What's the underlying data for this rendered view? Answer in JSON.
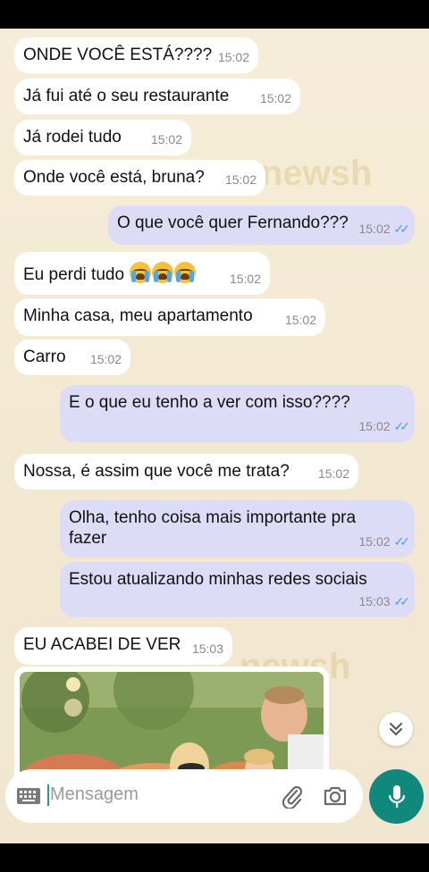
{
  "messages": [
    {
      "text": "ONDE VOCÊ ESTÁ????",
      "time": "15:02",
      "dir": "in"
    },
    {
      "text": "Já fui até o seu restaurante",
      "time": "15:02",
      "dir": "in"
    },
    {
      "text": "Já rodei tudo",
      "time": "15:02",
      "dir": "in"
    },
    {
      "text": "Onde você está, bruna?",
      "time": "15:02",
      "dir": "in"
    },
    {
      "text": "O que você quer Fernando???",
      "time": "15:02",
      "dir": "out",
      "status": "read"
    },
    {
      "text": "Eu perdi tudo",
      "time": "15:02",
      "dir": "in",
      "emoji": [
        "loudly-crying-face",
        "loudly-crying-face",
        "loudly-crying-face"
      ]
    },
    {
      "text": "Minha casa, meu apartamento",
      "time": "15:02",
      "dir": "in"
    },
    {
      "text": "Carro",
      "time": "15:02",
      "dir": "in"
    },
    {
      "text": "E o que eu tenho a ver com isso????",
      "time": "15:02",
      "dir": "out",
      "status": "read"
    },
    {
      "text": "Nossa, é assim que você me trata?",
      "time": "15:02",
      "dir": "in"
    },
    {
      "text": "Olha, tenho coisa mais importante pra fazer",
      "time": "15:02",
      "dir": "out",
      "status": "read"
    },
    {
      "text": "Estou atualizando minhas redes sociais",
      "time": "15:03",
      "dir": "out",
      "status": "read"
    },
    {
      "text": "EU ACABEI DE VER",
      "time": "15:03",
      "dir": "in"
    }
  ],
  "photo_message": {
    "dir": "in",
    "description_icon": "family-photo"
  },
  "input": {
    "placeholder": "Mensagem"
  },
  "icons": {
    "keyboard": "keyboard-icon",
    "attach": "paperclip-icon",
    "camera": "camera-icon",
    "mic": "microphone-icon",
    "scroll": "double-chevron-down-icon",
    "read": "double-check-icon"
  },
  "colors": {
    "incoming_bubble": "#ffffff",
    "outgoing_bubble": "#dcdcf6",
    "read_check": "#4aa3e0",
    "mic_button": "#11887c",
    "caret": "#1aa286"
  },
  "watermark": "newsh"
}
